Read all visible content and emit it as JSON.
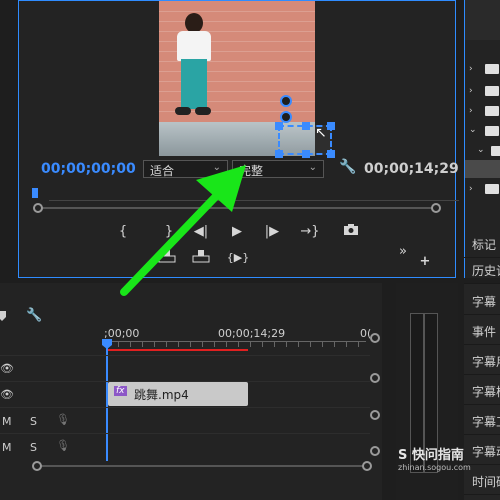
{
  "program_monitor": {
    "current_timecode": "00;00;00;00",
    "zoom_select": "适合",
    "quality_select": "完整",
    "duration_timecode": "00;00;14;29",
    "controls": {
      "mark_in": "{",
      "mark_out": "}",
      "go_to_in": "{←",
      "step_back": "◀|",
      "play": "▶",
      "step_forward": "|▶",
      "go_to_out": "→}",
      "export_frame": "📷",
      "lift": "⊟",
      "extract": "⊞",
      "trim": "{▶}",
      "more": "»",
      "add": "+"
    }
  },
  "side_menu": {
    "items": [
      "标记",
      "历史记",
      "字幕",
      "事件",
      "字幕用",
      "字幕样",
      "字幕工",
      "字幕动",
      "时间码"
    ]
  },
  "timeline": {
    "ruler": {
      "start": ";00;00",
      "mid": "00;00;14;29",
      "end": "0("
    },
    "clip": {
      "fx_badge": "fx",
      "name": "跳舞.mp4"
    },
    "audio_track_labels": {
      "mute": "M",
      "solo": "S"
    }
  },
  "watermark": {
    "text": "S 快问指南",
    "url": "zhinan.sogou.com"
  },
  "colors": {
    "accent": "#2f8cff",
    "timecode_blue": "#3a8bff",
    "clip": "#c9c9c9",
    "playhead": "#3a8bff",
    "work_area": "#e02020",
    "annotation_arrow": "#19e619"
  }
}
